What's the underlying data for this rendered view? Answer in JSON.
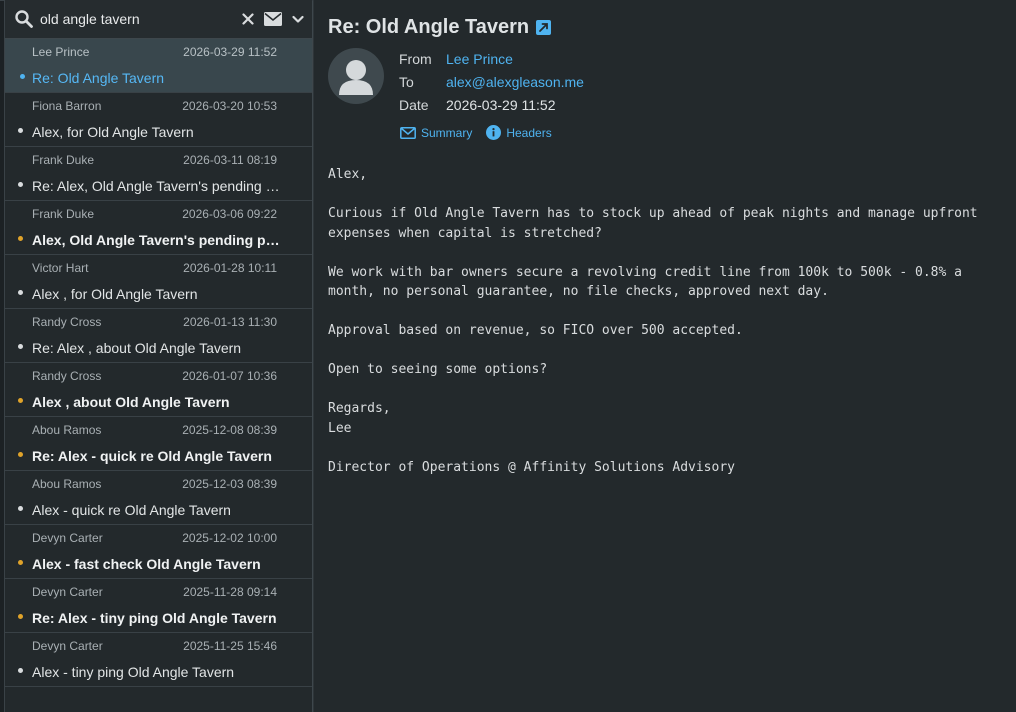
{
  "search": {
    "value": "old angle tavern",
    "clear_label": "✕"
  },
  "messages": [
    {
      "from": "Lee Prince",
      "date": "2026-03-29 11:52",
      "subject": "Re: Old Angle Tavern",
      "state": "selected"
    },
    {
      "from": "Fiona Barron",
      "date": "2026-03-20 10:53",
      "subject": "Alex, for Old Angle Tavern",
      "state": "read"
    },
    {
      "from": "Frank Duke",
      "date": "2026-03-11 08:19",
      "subject": "Re: Alex, Old Angle Tavern's pending p…",
      "state": "read"
    },
    {
      "from": "Frank Duke",
      "date": "2026-03-06 09:22",
      "subject": "Alex, Old Angle Tavern's pending pay…",
      "state": "unread"
    },
    {
      "from": "Victor Hart",
      "date": "2026-01-28 10:11",
      "subject": "Alex , for Old Angle Tavern",
      "state": "read"
    },
    {
      "from": "Randy Cross",
      "date": "2026-01-13 11:30",
      "subject": "Re: Alex , about Old Angle Tavern",
      "state": "read"
    },
    {
      "from": "Randy Cross",
      "date": "2026-01-07 10:36",
      "subject": "Alex , about Old Angle Tavern",
      "state": "unread"
    },
    {
      "from": "Abou Ramos",
      "date": "2025-12-08 08:39",
      "subject": "Re: Alex - quick re Old Angle Tavern",
      "state": "unread"
    },
    {
      "from": "Abou Ramos",
      "date": "2025-12-03 08:39",
      "subject": "Alex - quick re Old Angle Tavern",
      "state": "read"
    },
    {
      "from": "Devyn Carter",
      "date": "2025-12-02 10:00",
      "subject": "Alex - fast check Old Angle Tavern",
      "state": "unread"
    },
    {
      "from": "Devyn Carter",
      "date": "2025-11-28 09:14",
      "subject": "Re: Alex - tiny ping Old Angle Tavern",
      "state": "unread"
    },
    {
      "from": "Devyn Carter",
      "date": "2025-11-25 15:46",
      "subject": "Alex - tiny ping Old Angle Tavern",
      "state": "read"
    }
  ],
  "reader": {
    "title": "Re: Old Angle Tavern",
    "from_label": "From",
    "from_value": "Lee Prince",
    "to_label": "To",
    "to_value": "alex@alexgleason.me",
    "date_label": "Date",
    "date_value": "2026-03-29 11:52",
    "summary_tab": "Summary",
    "headers_tab": "Headers",
    "body": "Alex,\n\nCurious if Old Angle Tavern has to stock up ahead of peak nights and manage upfront\nexpenses when capital is stretched?\n\nWe work with bar owners secure a revolving credit line from 100k to 500k - 0.8% a\nmonth, no personal guarantee, no file checks, approved next day.\n\nApproval based on revenue, so FICO over 500 accepted.\n\nOpen to seeing some options?\n\nRegards,\nLee\n\nDirector of Operations @ Affinity Solutions Advisory"
  },
  "colors": {
    "accent": "#4fb3f0",
    "unread_dot": "#e0a32a",
    "background": "#23292c",
    "selected_row": "#39474d"
  },
  "icons": {
    "search": "search-icon",
    "clear": "close-icon",
    "mail": "envelope-icon",
    "menu": "chevron-down-icon",
    "popout": "external-link-icon",
    "avatar": "user-avatar-icon",
    "summary": "envelope-icon",
    "headers": "info-icon"
  }
}
